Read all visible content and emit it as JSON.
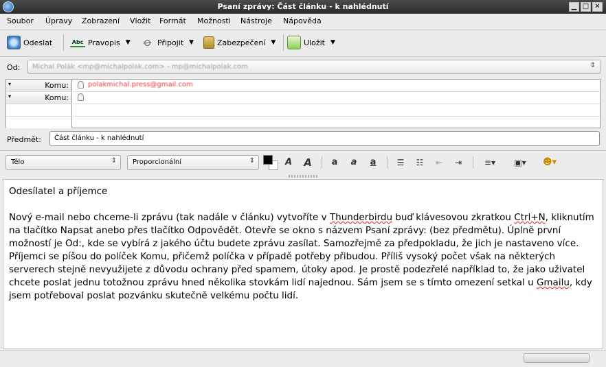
{
  "window": {
    "title": "Psaní zprávy: Část článku - k nahlédnutí"
  },
  "menu": [
    "Soubor",
    "Úpravy",
    "Zobrazení",
    "Vložit",
    "Formát",
    "Možnosti",
    "Nástroje",
    "Nápověda"
  ],
  "toolbar": {
    "send_label": "Odeslat",
    "spell_label": "Pravopis",
    "attach_label": "Připojit",
    "security_label": "Zabezpečení",
    "save_label": "Uložit"
  },
  "from": {
    "label": "Od:",
    "value": "Michal Polák <mp@michalpolak.com>  - mp@michalpolak.com"
  },
  "recipients": [
    {
      "type": "Komu:",
      "address": "polakmichal.press@gmail.com"
    },
    {
      "type": "Komu:",
      "address": ""
    }
  ],
  "subject": {
    "label": "Předmět:",
    "value": "Část článku - k nahlédnutí"
  },
  "format": {
    "paragraph": "Tělo",
    "font": "Proporcionální"
  },
  "message": {
    "heading": "Odesílatel a příjemce",
    "paragraph": [
      "Nový e-mail nebo chceme-li zprávu (tak nadále v článku) vytvoříte v ",
      "Thunderbirdu",
      " buď klávesovou zkratkou ",
      "Ctrl+N",
      ", kliknutím na tlačítko Napsat anebo přes tlačítko Odpovědět. Otevře se okno s názvem Psaní zprávy: (bez předmětu). Úplně první možností je Od:, kde se vybírá z jakého účtu budete zprávu zasílat. Samozřejmě za předpokladu, že jich je nastaveno více. Příjemci se píšou do políček Komu, přičemž políčka v případě potřeby přibudou. Příliš vysoký počet však na některých serverech stejně nevyužijete z důvodu ochrany před spamem, útoky apod. Je prostě podezřelé například to, že jako uživatel chcete poslat jednu totožnou zprávu hned několika stovkám lidí najednou. Sám jsem se s tímto omezení setkal u ",
      "Gmailu",
      ", kdy jsem potřeboval poslat pozvánku skutečně velkému počtu lidí."
    ]
  }
}
